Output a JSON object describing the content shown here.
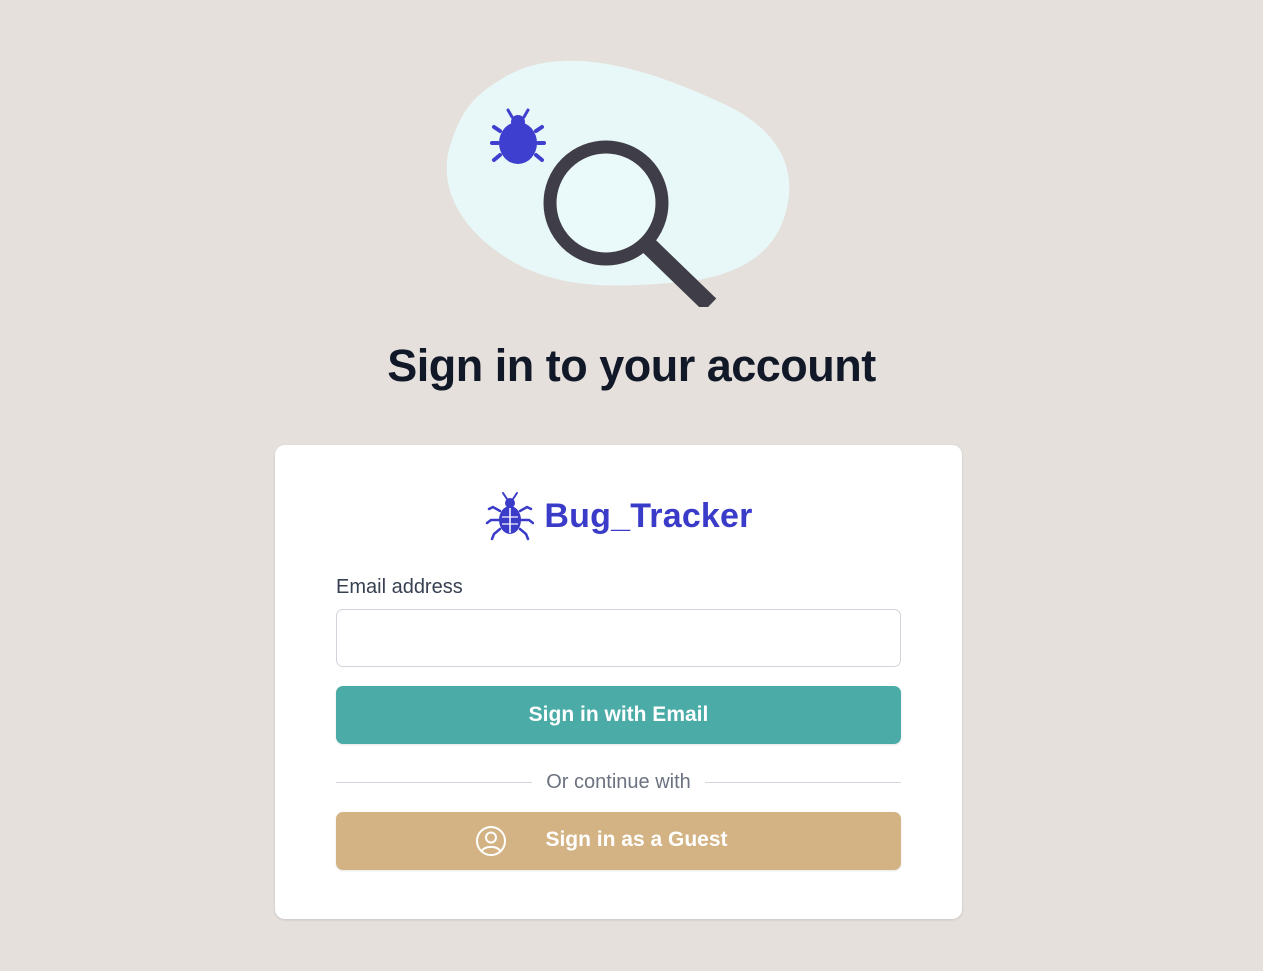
{
  "page": {
    "title": "Sign in to your account"
  },
  "brand": {
    "name": "Bug_Tracker",
    "icon": "bug-icon",
    "color": "#3b3bc9"
  },
  "hero": {
    "illustration": "bug-magnifier-illustration"
  },
  "form": {
    "email_label": "Email address",
    "email_value": "",
    "email_placeholder": "",
    "email_button": "Sign in with Email",
    "divider_text": "Or continue with",
    "guest_button": "Sign in as a Guest",
    "guest_icon": "user-circle-icon"
  },
  "colors": {
    "background": "#e5e0dc",
    "email_button": "#4aaba7",
    "guest_button": "#d3b383",
    "title": "#111827"
  }
}
